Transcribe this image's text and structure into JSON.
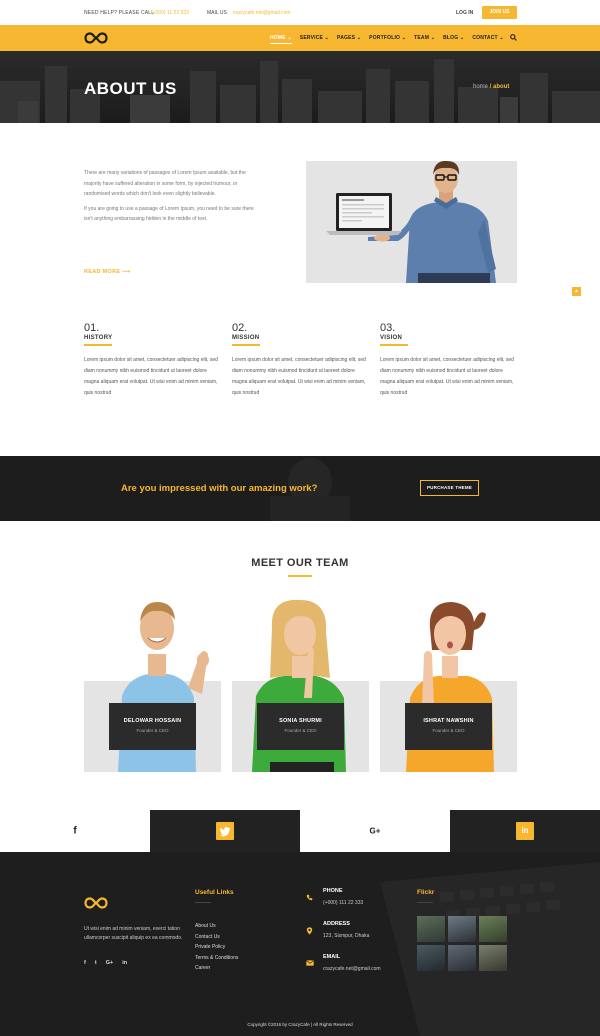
{
  "topbar": {
    "help_label": "NEED HELP? PLEASE CALL",
    "phone": "(+000) 11 22 333",
    "mail_label": "MAIL US",
    "mail": "crazycafe.net@gmail.com",
    "login": "LOG IN",
    "join": "JOIN US"
  },
  "nav": {
    "items": [
      "HOME",
      "SERVICE",
      "PAGES",
      "PORTFOLIO",
      "TEAM",
      "BLOG",
      "CONTACT"
    ],
    "chevrons": [
      true,
      true,
      true,
      true,
      true,
      true,
      true
    ]
  },
  "hero": {
    "title": "ABOUT US",
    "crumb_home": "home",
    "crumb_sep": " / ",
    "crumb_current": "about"
  },
  "about": {
    "p1": "There are many variations of passages of Lorem Ipsum available, but the majority have suffered alteration in some form, by injected humour, or randomised words which don't look even slightly believable.",
    "p2": "If you are going to use a passage of Lorem Ipsum, you need to be sure there isn't anything embarrassing hidden in the middle of text.",
    "read_more": "READ MORE"
  },
  "features": [
    {
      "num": "01.",
      "title": "HISTORY",
      "text": "Lorem ipsum dolor sit amet, consectetuer adipiscing elit, sed diam nonummy nibh euismod tincidunt ut laoreet dolore magna aliquam erat volutpat. Ut wisi enim ad minim veniam, quis nostrud"
    },
    {
      "num": "02.",
      "title": "MISSION",
      "text": "Lorem ipsum dolor sit amet, consectetuer adipiscing elit, sed diam nonummy nibh euismod tincidunt ut laoreet dolore magna aliquam erat volutpat. Ut wisi enim ad minim veniam, quis nostrud"
    },
    {
      "num": "03.",
      "title": "VISION",
      "text": "Lorem ipsum dolor sit amet, consectetuer adipiscing elit, sed diam nonummy nibh euismod tincidunt ut laoreet dolore magna aliquam erat volutpat. Ut wisi enim ad minim veniam, quis nostrud"
    }
  ],
  "cta": {
    "question": "Are you impressed with our amazing work?",
    "button": "PURCHASE THEME"
  },
  "team": {
    "title": "MEET OUR TEAM",
    "members": [
      {
        "name": "DELOWAR HOSSAIN",
        "role": "Founder & CEO",
        "shirt": "#8ec3e8",
        "hair": "#b9874a"
      },
      {
        "name": "SONIA SHURMI",
        "role": "Founder & CEO",
        "shirt": "#3cab3c",
        "hair": "#e3b86c"
      },
      {
        "name": "ISHRAT NAWSHIN",
        "role": "Founder & CEO",
        "shirt": "#f4a72a",
        "hair": "#8a4a2c"
      }
    ]
  },
  "social": [
    {
      "icon": "facebook-icon",
      "glyph": "f"
    },
    {
      "icon": "twitter-icon",
      "glyph": "t"
    },
    {
      "icon": "google-plus-icon",
      "glyph": "G+"
    },
    {
      "icon": "linkedin-icon",
      "glyph": "in"
    }
  ],
  "footer": {
    "about": "Ut wisi enim ad minim veniam, exerci tation ullamcorper suscipit aliquip ex ea commodo.",
    "social": [
      "f",
      "t",
      "G+",
      "in"
    ],
    "links_title": "Useful Links",
    "links": [
      "About Us",
      "Contact Us",
      "Private Policy",
      "Terms & Conditions",
      "Career"
    ],
    "contact": [
      {
        "label": "PHONE",
        "value": "(+000) 111 22 333",
        "icon": "phone-icon"
      },
      {
        "label": "ADDRESS",
        "value": "123, Sismpur, Dhaka",
        "icon": "location-icon"
      },
      {
        "label": "EMAIL",
        "value": "crazycafe.net@gmail.com",
        "icon": "mail-icon"
      }
    ],
    "flickr_title": "Flickr",
    "copyright": "Copyright ©2016 by CrazyCafe  |  All Rights Reserved"
  },
  "colors": {
    "accent": "#f7b731",
    "dark": "#1e1e1e"
  }
}
